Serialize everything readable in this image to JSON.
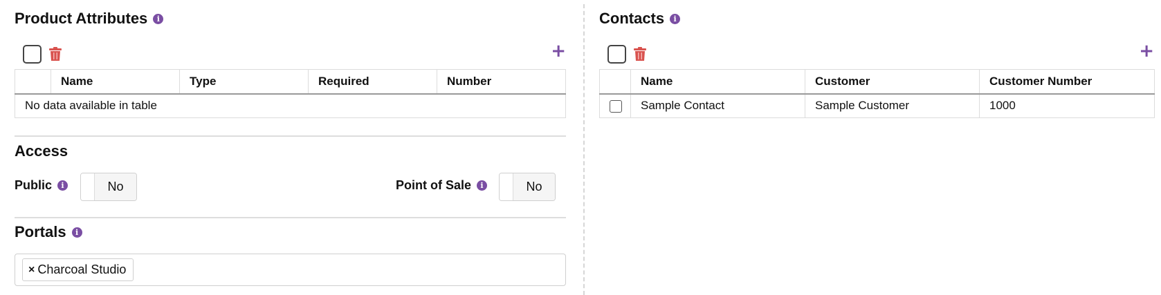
{
  "product_attributes": {
    "title": "Product Attributes",
    "columns": [
      "",
      "Name",
      "Type",
      "Required",
      "Number"
    ],
    "empty_message": "No data available in table"
  },
  "access": {
    "title": "Access",
    "public_label": "Public",
    "public_value": "No",
    "pos_label": "Point of Sale",
    "pos_value": "No"
  },
  "portals": {
    "title": "Portals",
    "tags": [
      "Charcoal Studio"
    ],
    "remove_glyph": "×"
  },
  "contacts": {
    "title": "Contacts",
    "columns": [
      "",
      "Name",
      "Customer",
      "Customer Number"
    ],
    "rows": [
      {
        "name": "Sample Contact",
        "customer": "Sample Customer",
        "customer_number": "1000"
      }
    ]
  },
  "icons": {
    "info": "info-icon",
    "trash": "trash-icon",
    "plus": "plus-icon"
  },
  "colors": {
    "accent": "#7a4ea3",
    "danger": "#d9534f"
  }
}
